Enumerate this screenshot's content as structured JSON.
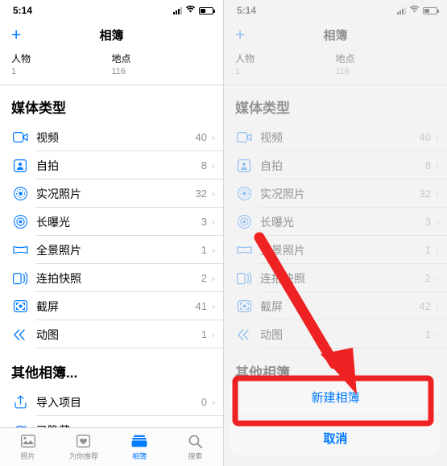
{
  "status": {
    "time": "5:14",
    "signal_icon": "signal-bars-icon",
    "wifi_icon": "wifi-icon",
    "battery_icon": "battery-icon"
  },
  "nav": {
    "add_label": "+",
    "title": "相簿"
  },
  "people_places": [
    {
      "title": "人物",
      "count": "1"
    },
    {
      "title": "地点",
      "count": "116"
    }
  ],
  "media_section": {
    "title": "媒体类型",
    "rows_left": [
      {
        "icon": "video-icon",
        "label": "视频",
        "count": "40"
      },
      {
        "icon": "selfie-icon",
        "label": "自拍",
        "count": "8"
      },
      {
        "icon": "live-photo-icon",
        "label": "实况照片",
        "count": "32"
      },
      {
        "icon": "long-exposure-icon",
        "label": "长曝光",
        "count": "3"
      },
      {
        "icon": "panorama-icon",
        "label": "全景照片",
        "count": "1"
      },
      {
        "icon": "burst-icon",
        "label": "连拍快照",
        "count": "2"
      },
      {
        "icon": "screenshot-icon",
        "label": "截屏",
        "count": "41"
      },
      {
        "icon": "animated-icon",
        "label": "动图",
        "count": "1"
      }
    ],
    "rows_right": [
      {
        "icon": "video-icon",
        "label": "视频",
        "count": "40"
      },
      {
        "icon": "selfie-icon",
        "label": "自拍",
        "count": "8"
      },
      {
        "icon": "live-photo-icon",
        "label": "实况照片",
        "count": "32"
      },
      {
        "icon": "long-exposure-icon",
        "label": "长曝光",
        "count": "3"
      },
      {
        "icon": "panorama-icon",
        "label": "全景照片",
        "count": "1"
      },
      {
        "icon": "burst-icon",
        "label": "连拍快照",
        "count": "2"
      },
      {
        "icon": "screenshot-icon",
        "label": "截屏",
        "count": "42"
      },
      {
        "icon": "animated-icon",
        "label": "动图",
        "count": "1"
      }
    ]
  },
  "other_section": {
    "title": "其他相簿...",
    "rows": [
      {
        "icon": "import-icon",
        "label": "导入项目",
        "count": "0"
      },
      {
        "icon": "hidden-icon",
        "label": "已隐藏",
        "count": ""
      }
    ]
  },
  "tabbar": {
    "tabs": [
      {
        "icon": "photos-icon",
        "label": "照片",
        "active": false
      },
      {
        "icon": "for-you-icon",
        "label": "为你推荐",
        "active": false
      },
      {
        "icon": "albums-icon",
        "label": "相簿",
        "active": true
      },
      {
        "icon": "search-icon",
        "label": "搜索",
        "active": false
      }
    ]
  },
  "action_sheet": {
    "new_album": "新建相簿",
    "cancel": "取消"
  },
  "annotation": {
    "color": "#ee2222",
    "arrow": "down-right-arrow",
    "highlight_target": "新建相簿"
  }
}
